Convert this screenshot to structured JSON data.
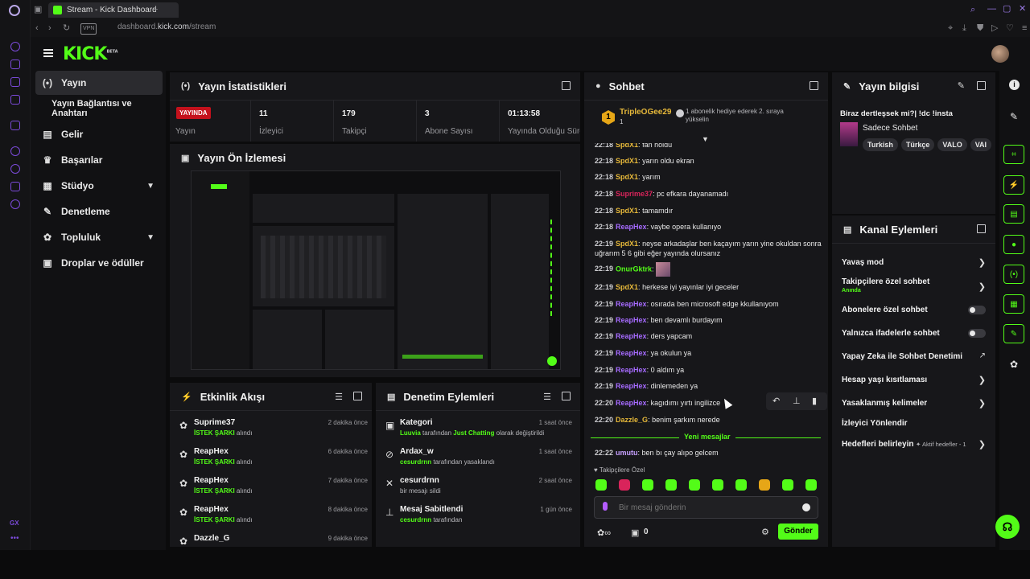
{
  "browser": {
    "tab_title": "Stream - Kick Dashboard",
    "url_host": "dashboard.",
    "url_domain": "kick.com",
    "url_path": "/stream",
    "vpn_label": "VPN"
  },
  "app": {
    "logo": "KICK",
    "logo_tag": "BETA"
  },
  "nav": {
    "items": [
      {
        "label": "Yayın",
        "icon": "broadcast-icon",
        "active": true
      },
      {
        "label": "Yayın Bağlantısı ve Anahtarı",
        "icon": "",
        "sub": true
      },
      {
        "label": "Gelir",
        "icon": "revenue-icon"
      },
      {
        "label": "Başarılar",
        "icon": "trophy-icon"
      },
      {
        "label": "Stüdyo",
        "icon": "studio-icon",
        "chevron": true
      },
      {
        "label": "Denetleme",
        "icon": "wrench-icon"
      },
      {
        "label": "Topluluk",
        "icon": "community-icon",
        "chevron": true
      },
      {
        "label": "Droplar ve ödüller",
        "icon": "drops-icon"
      }
    ]
  },
  "stats": {
    "title": "Yayın İstatistikleri",
    "live_badge": "YAYINDA",
    "cells": [
      {
        "value": "",
        "label": "Yayın"
      },
      {
        "value": "11",
        "label": "İzleyici"
      },
      {
        "value": "179",
        "label": "Takipçi"
      },
      {
        "value": "3",
        "label": "Abone Sayısı"
      },
      {
        "value": "01:13:58",
        "label": "Yayında Olduğu Süre"
      }
    ]
  },
  "preview": {
    "title": "Yayın Ön İzlemesi"
  },
  "activity": {
    "title": "Etkinlik Akışı",
    "items": [
      {
        "name": "Suprime37",
        "tag": "İSTEK ŞARKI",
        "suffix": "alındı",
        "time": "2 dakika önce"
      },
      {
        "name": "ReapHex",
        "tag": "İSTEK ŞARKI",
        "suffix": "alındı",
        "time": "6 dakika önce"
      },
      {
        "name": "ReapHex",
        "tag": "İSTEK ŞARKI",
        "suffix": "alındı",
        "time": "7 dakika önce"
      },
      {
        "name": "ReapHex",
        "tag": "İSTEK ŞARKI",
        "suffix": "alındı",
        "time": "8 dakika önce"
      },
      {
        "name": "Dazzle_G",
        "tag": "",
        "suffix": "",
        "time": "9 dakika önce"
      }
    ]
  },
  "moderation": {
    "title": "Denetim Eylemleri",
    "items": [
      {
        "name": "Kategori",
        "actor": "Luuvia",
        "mid": "tarafından",
        "target": "Just Chatting",
        "tail": "olarak değiştirildi",
        "time": "1 saat önce"
      },
      {
        "name": "Ardax_w",
        "actor": "cesurdrnn",
        "mid": "tarafından yasaklandı",
        "target": "",
        "tail": "",
        "time": "1 saat önce"
      },
      {
        "name": "cesurdrnn",
        "actor": "",
        "mid": "bir mesajı sildi",
        "target": "",
        "tail": "",
        "time": "2 saat önce"
      },
      {
        "name": "Mesaj Sabitlendi",
        "actor": "cesurdrnn",
        "mid": "tarafından",
        "target": "",
        "tail": "",
        "time": "1 gün önce"
      }
    ]
  },
  "chat": {
    "title": "Sohbet",
    "pinned_user": "TripleOGee29",
    "pinned_count": "1",
    "gift_text": "1 abonelik hediye ederek 2. sıraya yükselin",
    "messages": [
      {
        "time": "22:18",
        "user": "SpdX1",
        "color": "#e6b83a",
        "text": "fan holdu"
      },
      {
        "time": "22:18",
        "user": "SpdX1",
        "color": "#e6b83a",
        "text": "yarın oldu ekran"
      },
      {
        "time": "22:18",
        "user": "SpdX1",
        "color": "#e6b83a",
        "text": "yarım"
      },
      {
        "time": "22:18",
        "user": "Suprime37",
        "color": "#d9245b",
        "text": "pc efkara dayanamadı"
      },
      {
        "time": "22:18",
        "user": "SpdX1",
        "color": "#e6b83a",
        "text": "tamamdır"
      },
      {
        "time": "22:18",
        "user": "ReapHex",
        "color": "#a66bff",
        "text": "vaybe opera kullanıyo"
      },
      {
        "time": "22:19",
        "user": "SpdX1",
        "color": "#e6b83a",
        "text": "neyse arkadaşlar ben kaçayım yarın yine okuldan sonra uğrarım 5 6 gibi eğer yayında olursanız"
      },
      {
        "time": "22:19",
        "user": "OnurGktrk",
        "color": "#53fc18",
        "text": ""
      },
      {
        "time": "22:19",
        "user": "SpdX1",
        "color": "#e6b83a",
        "text": "herkese iyi yayınlar iyi geceler"
      },
      {
        "time": "22:19",
        "user": "ReapHex",
        "color": "#a66bff",
        "text": "osırada ben microsoft edge kkullanıyom"
      },
      {
        "time": "22:19",
        "user": "ReapHex",
        "color": "#a66bff",
        "text": "ben devamlı burdayım"
      },
      {
        "time": "22:19",
        "user": "ReapHex",
        "color": "#a66bff",
        "text": "ders yapcam"
      },
      {
        "time": "22:19",
        "user": "ReapHex",
        "color": "#a66bff",
        "text": "ya okulun ya"
      },
      {
        "time": "22:19",
        "user": "ReapHex",
        "color": "#a66bff",
        "text": "0 aldım ya"
      },
      {
        "time": "22:19",
        "user": "ReapHex",
        "color": "#a66bff",
        "text": "dinlemeden ya"
      },
      {
        "time": "22:20",
        "user": "ReapHex",
        "color": "#a66bff",
        "text": "kagıdımı yırtı ingilizce"
      },
      {
        "time": "22:20",
        "user": "Dazzle_G",
        "color": "#e6b83a",
        "text": "benim şarkım nerede"
      }
    ],
    "new_messages": "Yeni mesajlar",
    "after_new": {
      "time": "22:22",
      "user": "umutu",
      "color": "#c7a0ff",
      "text": "ben bı çay alıpo gelcem"
    },
    "followers_only": "Takipçilere Özel",
    "input_placeholder": "Bir mesaj gönderin",
    "points": "0",
    "send": "Gönder"
  },
  "stream_info": {
    "title": "Yayın bilgisi",
    "stream_title": "Biraz dertleşsek mi?| !dc !insta",
    "category": "Sadece Sohbet",
    "tags": [
      "Turkish",
      "Türkçe",
      "VALO",
      "VAI"
    ]
  },
  "channel_actions": {
    "title": "Kanal Eylemleri",
    "items": [
      {
        "label": "Yavaş mod",
        "sub": "",
        "control": "chevron"
      },
      {
        "label": "Takipçilere özel sohbet",
        "sub": "Anında",
        "control": "chevron"
      },
      {
        "label": "Abonelere özel sohbet",
        "sub": "",
        "control": "toggle"
      },
      {
        "label": "Yalnızca ifadelerle sohbet",
        "sub": "",
        "control": "toggle"
      },
      {
        "label": "Yapay Zeka ile Sohbet Denetimi",
        "sub": "",
        "control": "link"
      },
      {
        "label": "Hesap yaşı kısıtlaması",
        "sub": "",
        "control": "chevron"
      },
      {
        "label": "Yasaklanmış kelimeler",
        "sub": "",
        "control": "chevron"
      },
      {
        "label": "İzleyici Yönlendir",
        "sub": "",
        "control": "none"
      },
      {
        "label": "Hedefleri belirleyin",
        "sub": "",
        "control": "chevron",
        "right_note": "Aktif hedefler - 1"
      }
    ]
  },
  "colors": {
    "accent": "#53fc18",
    "live": "#c4111c",
    "panel": "#17171a"
  }
}
